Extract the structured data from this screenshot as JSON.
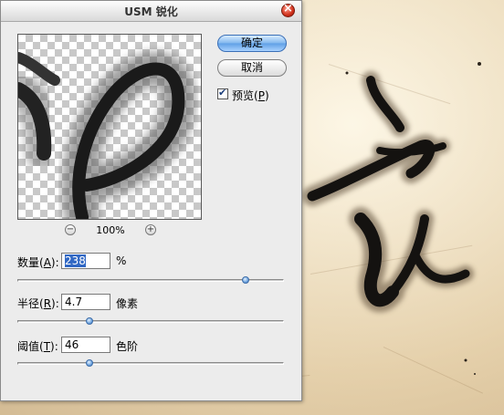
{
  "dialog": {
    "title": "USM 锐化",
    "buttons": {
      "ok": "确定",
      "cancel": "取消"
    },
    "preview_checkbox": {
      "label_prefix": "预览(",
      "mnemonic": "P",
      "label_suffix": ")",
      "checked": true
    },
    "zoom": {
      "minus_icon": "−",
      "plus_icon": "+",
      "level": "100%"
    },
    "params": [
      {
        "label_prefix": "数量(",
        "mnemonic": "A",
        "label_suffix": "):",
        "value": "238",
        "unit": "%",
        "slider_fraction": 0.86,
        "selected": true
      },
      {
        "label_prefix": "半径(",
        "mnemonic": "R",
        "label_suffix": "):",
        "value": "4.7",
        "unit": "像素",
        "slider_fraction": 0.27,
        "selected": false
      },
      {
        "label_prefix": "阈值(",
        "mnemonic": "T",
        "label_suffix": "):",
        "value": "46",
        "unit": "色阶",
        "slider_fraction": 0.27,
        "selected": false
      }
    ]
  },
  "colors": {
    "accent": "#3168c4",
    "close": "#d0311c",
    "ink": "#111111",
    "paper": "#e9d8b6"
  },
  "icons": {
    "close": "close-icon",
    "zoom_out": "zoom-out-icon",
    "zoom_in": "zoom-in-icon",
    "check": "check-icon"
  }
}
